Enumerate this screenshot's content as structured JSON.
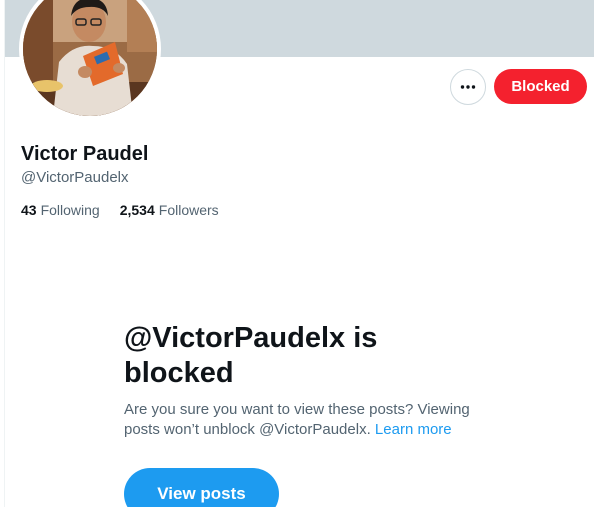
{
  "profile": {
    "display_name": "Victor Paudel",
    "handle": "@VictorPaudelx",
    "following_count": "43",
    "following_label": "Following",
    "followers_count": "2,534",
    "followers_label": "Followers"
  },
  "actions": {
    "more_icon": "more-horizontal-icon",
    "blocked_label": "Blocked"
  },
  "blocked_notice": {
    "title": "@VictorPaudelx is blocked",
    "description": "Are you sure you want to view these posts? Viewing posts won’t unblock @VictorPaudelx.",
    "learn_more": "Learn more",
    "view_posts_label": "View posts"
  },
  "colors": {
    "banner": "#cfd9de",
    "blocked_red": "#f4212e",
    "accent_blue": "#1d9bf0",
    "secondary_text": "#536471"
  }
}
